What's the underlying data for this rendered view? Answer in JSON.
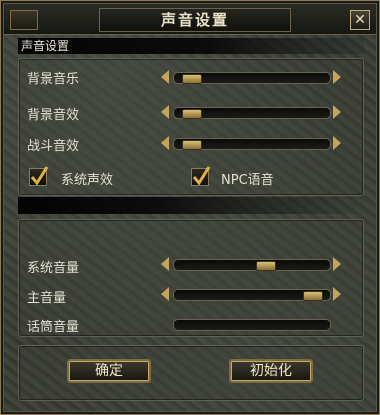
{
  "window": {
    "title": "声音设置",
    "close_glyph": "✕"
  },
  "header": {
    "label": "声音设置"
  },
  "settings": [
    {
      "label": "背景音乐",
      "level": 0.06
    },
    {
      "label": "背景音效",
      "level": 0.06
    },
    {
      "label": "战斗音效",
      "level": 0.06
    }
  ],
  "checkboxes": [
    {
      "label": "系统声效",
      "checked": true
    },
    {
      "label": "NPC语音",
      "checked": true
    }
  ],
  "volumes": [
    {
      "label": "系统音量",
      "level": 0.6
    },
    {
      "label": "主音量",
      "level": 0.95
    },
    {
      "label": "话筒音量",
      "level": null
    }
  ],
  "buttons": {
    "confirm": "确定",
    "reset": "初始化"
  },
  "colors": {
    "accent": "#c4a45a",
    "text": "#e4e0d2",
    "thumb": "#d9c27a"
  }
}
